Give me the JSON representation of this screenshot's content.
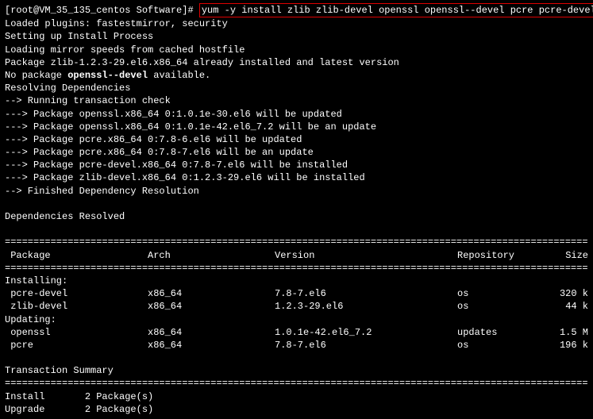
{
  "prompt": "[root@VM_35_135_centos Software]# ",
  "command": "yum  -y install zlib zlib-devel openssl openssl--devel pcre pcre-devel",
  "pre_lines": [
    "Loaded plugins: fastestmirror, security",
    "Setting up Install Process",
    "Loading mirror speeds from cached hostfile",
    "Package zlib-1.2.3-29.el6.x86_64 already installed and latest version"
  ],
  "nopkg_prefix": "No package ",
  "nopkg_name": "openssl--devel",
  "nopkg_suffix": " available.",
  "dep_lines": [
    "Resolving Dependencies",
    "--> Running transaction check",
    "---> Package openssl.x86_64 0:1.0.1e-30.el6 will be updated",
    "---> Package openssl.x86_64 0:1.0.1e-42.el6_7.2 will be an update",
    "---> Package pcre.x86_64 0:7.8-6.el6 will be updated",
    "---> Package pcre.x86_64 0:7.8-7.el6 will be an update",
    "---> Package pcre-devel.x86_64 0:7.8-7.el6 will be installed",
    "---> Package zlib-devel.x86_64 0:1.2.3-29.el6 will be installed",
    "--> Finished Dependency Resolution",
    "",
    "Dependencies Resolved",
    ""
  ],
  "headers": {
    "pkg": " Package",
    "arch": "Arch",
    "ver": "Version",
    "repo": "Repository",
    "size": "Size"
  },
  "sections": [
    {
      "title": "Installing:",
      "rows": [
        {
          "pkg": " pcre-devel",
          "arch": "x86_64",
          "ver": "7.8-7.el6",
          "repo": "os",
          "size": "320 k"
        },
        {
          "pkg": " zlib-devel",
          "arch": "x86_64",
          "ver": "1.2.3-29.el6",
          "repo": "os",
          "size": "44 k"
        }
      ]
    },
    {
      "title": "Updating:",
      "rows": [
        {
          "pkg": " openssl",
          "arch": "x86_64",
          "ver": "1.0.1e-42.el6_7.2",
          "repo": "updates",
          "size": "1.5 M"
        },
        {
          "pkg": " pcre",
          "arch": "x86_64",
          "ver": "7.8-7.el6",
          "repo": "os",
          "size": "196 k"
        }
      ]
    }
  ],
  "summary_title": "Transaction Summary",
  "summary_lines": [
    "Install       2 Package(s)",
    "Upgrade       2 Package(s)"
  ],
  "rule": "=================================================================================================================="
}
